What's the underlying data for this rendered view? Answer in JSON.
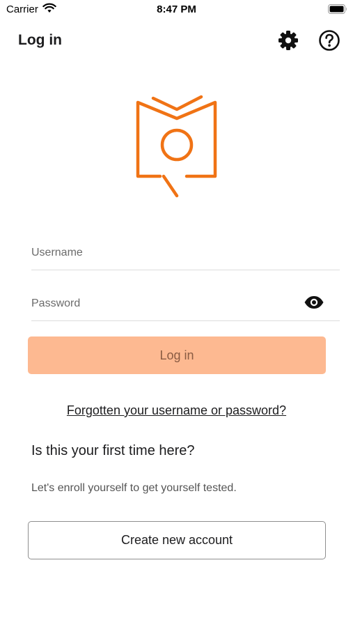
{
  "status_bar": {
    "carrier": "Carrier",
    "time": "8:47 PM",
    "icons": [
      "wifi-icon",
      "battery-icon"
    ]
  },
  "nav": {
    "title": "Log in",
    "icons": [
      "gear-icon",
      "help-circle-icon"
    ]
  },
  "logo": {
    "name": "app-logo-book-magnifier",
    "color": "#f07315"
  },
  "form": {
    "username_placeholder": "Username",
    "username_value": "",
    "password_placeholder": "Password",
    "password_value": "",
    "password_toggle_icon": "eye-icon",
    "login_label": "Log in"
  },
  "forgot_link": "Forgotten your username or password?",
  "enroll": {
    "heading": "Is this your first time here?",
    "description": "Let's enroll yourself to get yourself tested.",
    "create_label": "Create new account"
  },
  "colors": {
    "accent": "#f07315",
    "login_button_bg": "#fdb991",
    "login_button_text": "#8a5c43"
  }
}
